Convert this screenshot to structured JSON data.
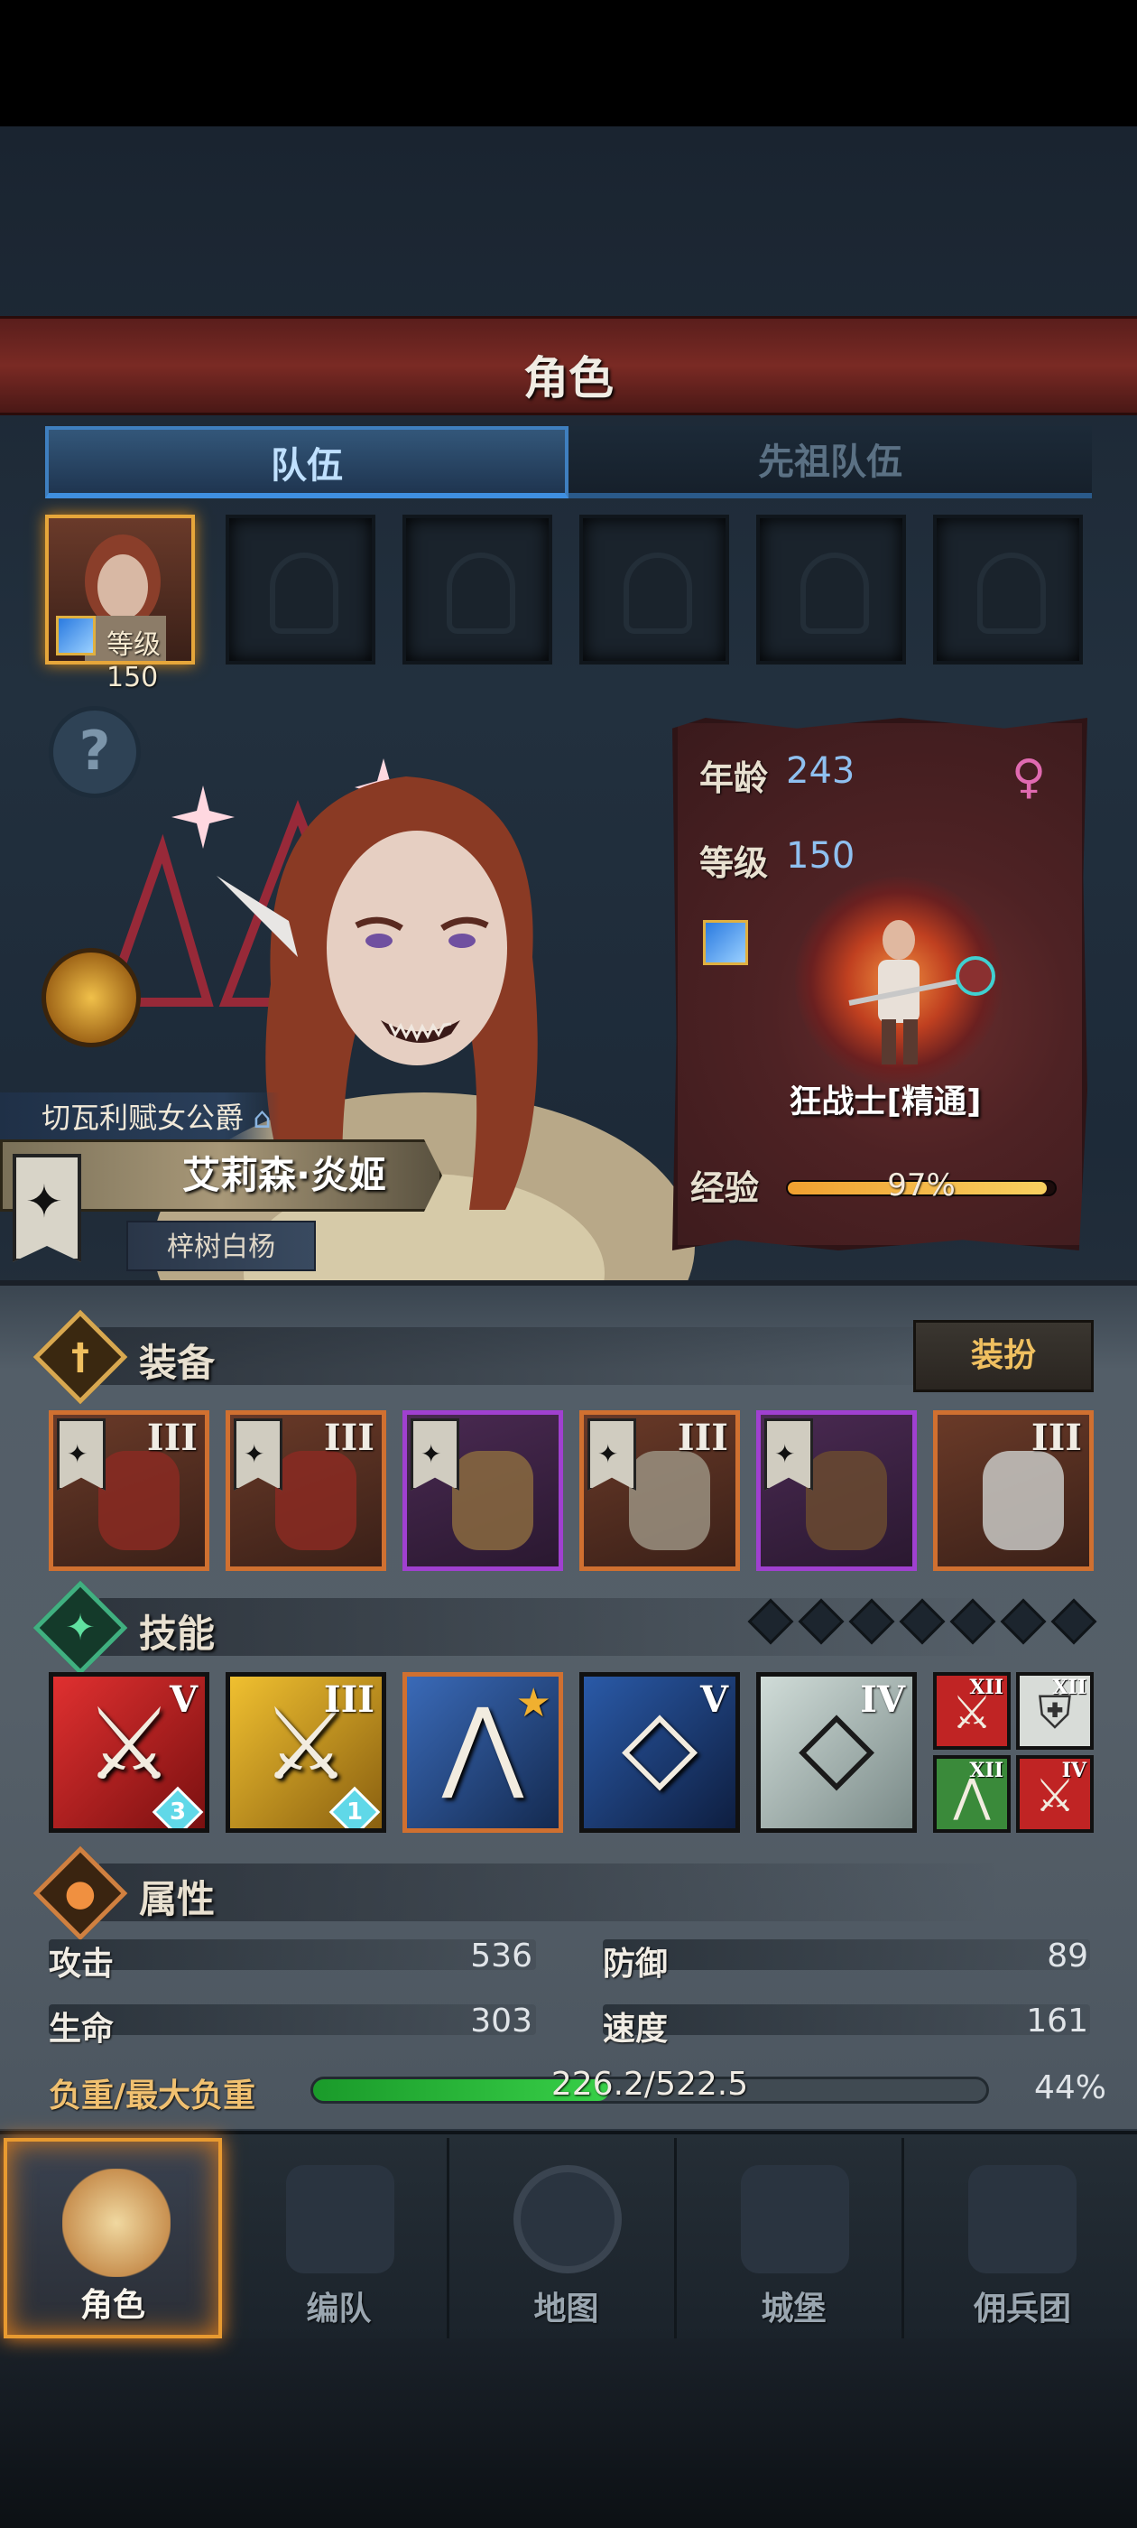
{
  "header": {
    "title": "角色"
  },
  "tabs": [
    {
      "label": "队伍"
    },
    {
      "label": "先祖队伍"
    }
  ],
  "party": {
    "slot1_level": "等级150"
  },
  "character": {
    "title": "切瓦利赋女公爵",
    "name": "艾莉森·炎姬",
    "subtitle": "梓树白杨",
    "age_label": "年龄",
    "age": "243",
    "level_label": "等级",
    "level": "150",
    "gender_icon": "♀",
    "class_name": "狂战士[精通]",
    "exp_label": "经验",
    "exp_text": "97%",
    "exp_fraction": 0.97
  },
  "equipment": {
    "title": "装备",
    "dress_button": "装扮",
    "items": [
      {
        "rank": "III",
        "rarity": "orange"
      },
      {
        "rank": "III",
        "rarity": "orange"
      },
      {
        "rank": "",
        "rarity": "purple"
      },
      {
        "rank": "III",
        "rarity": "orange"
      },
      {
        "rank": "",
        "rarity": "purple"
      },
      {
        "rank": "III",
        "rarity": "orange"
      }
    ]
  },
  "skills": {
    "title": "技能",
    "items": [
      {
        "rank": "V",
        "badge": "3"
      },
      {
        "rank": "III",
        "badge": "1"
      },
      {
        "rank": "",
        "badge": ""
      },
      {
        "rank": "V",
        "badge": ""
      },
      {
        "rank": "IV",
        "badge": ""
      }
    ],
    "mini": [
      {
        "rank": "XII"
      },
      {
        "rank": "XII"
      },
      {
        "rank": "XII"
      },
      {
        "rank": "IV"
      }
    ]
  },
  "attributes": {
    "title": "属性",
    "attack_label": "攻击",
    "attack": "536",
    "defense_label": "防御",
    "defense": "89",
    "hp_label": "生命",
    "hp": "303",
    "speed_label": "速度",
    "speed": "161",
    "weight_label": "负重/最大负重",
    "weight_text": "226.2/522.5",
    "weight_percent": "44%",
    "weight_fraction": 0.44
  },
  "nav": [
    {
      "label": "角色"
    },
    {
      "label": "编队"
    },
    {
      "label": "地图"
    },
    {
      "label": "城堡"
    },
    {
      "label": "佣兵团"
    }
  ],
  "colors": {
    "accent_orange": "#e89a30",
    "tab_blue": "#3f8fe0",
    "exp_gold": "#f0a030",
    "weight_green": "#38d048",
    "rarity_orange": "#d07030",
    "rarity_purple": "#a040d0"
  }
}
